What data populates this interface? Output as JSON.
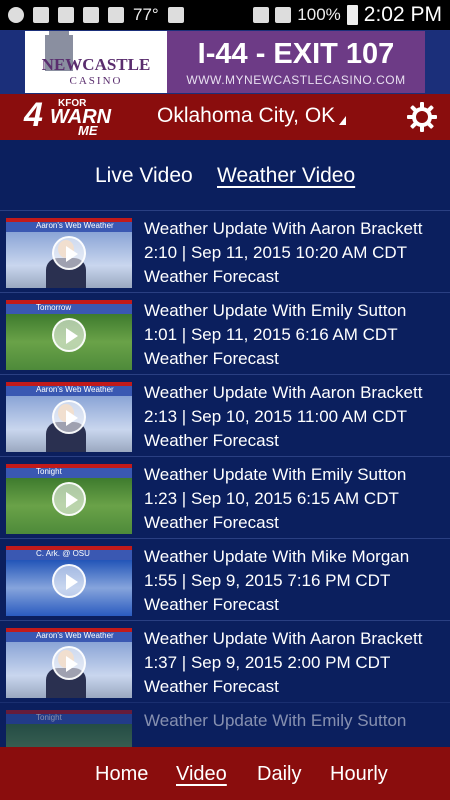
{
  "status_bar": {
    "temperature": "77°",
    "battery": "100%",
    "time": "2:02 PM"
  },
  "ad": {
    "brand": "NEWCASTLE",
    "brand_sub": "CASINO",
    "headline": "I-44 - EXIT 107",
    "url": "WWW.MYNEWCASTLECASINO.COM"
  },
  "header": {
    "logo_number": "4",
    "logo_kfor": "KFOR",
    "logo_warn": "WARN",
    "logo_me": "ME",
    "location": "Oklahoma City, OK"
  },
  "tabs": {
    "live": "Live Video",
    "weather": "Weather Video"
  },
  "videos": [
    {
      "title": "Weather Update With Aaron Brackett",
      "meta": "2:10 | Sep 11, 2015 10:20 AM CDT",
      "category": "Weather Forecast",
      "thumb_label": "Aaron's Web Weather"
    },
    {
      "title": "Weather Update With Emily Sutton",
      "meta": "1:01 | Sep 11, 2015 6:16 AM CDT",
      "category": "Weather Forecast",
      "thumb_label": "Tomorrow"
    },
    {
      "title": "Weather Update With Aaron Brackett",
      "meta": "2:13 | Sep 10, 2015 11:00 AM CDT",
      "category": "Weather Forecast",
      "thumb_label": "Aaron's Web Weather"
    },
    {
      "title": "Weather Update With Emily Sutton",
      "meta": "1:23 | Sep 10, 2015 6:15 AM CDT",
      "category": "Weather Forecast",
      "thumb_label": "Tonight"
    },
    {
      "title": "Weather Update With Mike Morgan",
      "meta": "1:55 | Sep 9, 2015 7:16 PM CDT",
      "category": "Weather Forecast",
      "thumb_label": "C. Ark. @ OSU"
    },
    {
      "title": "Weather Update With Aaron Brackett",
      "meta": "1:37 | Sep 9, 2015 2:00 PM CDT",
      "category": "Weather Forecast",
      "thumb_label": "Aaron's Web Weather"
    },
    {
      "title": "Weather Update With Emily Sutton",
      "meta": "",
      "category": "",
      "thumb_label": "Tonight"
    }
  ],
  "bottom_nav": {
    "home": "Home",
    "video": "Video",
    "daily": "Daily",
    "hourly": "Hourly"
  },
  "colors": {
    "brand_red": "#8a0d0d",
    "background_navy": "#0b1f5e",
    "ad_purple": "#6d3b86"
  }
}
